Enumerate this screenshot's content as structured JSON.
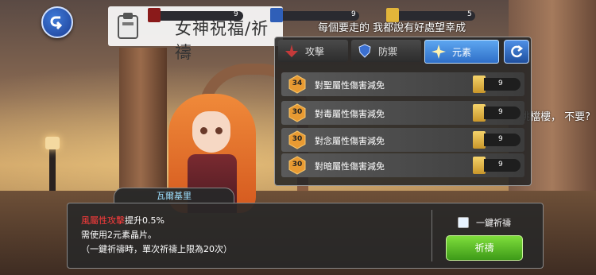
{
  "header": {
    "title": "女神祝福/祈禱",
    "stats": [
      {
        "icon": "red-shield-icon",
        "value": "9",
        "color": "#8a1a1a"
      },
      {
        "icon": "blue-shield-icon",
        "value": "9",
        "color": "#2f5fb8"
      },
      {
        "icon": "gold-star-icon",
        "value": "5",
        "color": "#e2b53a"
      }
    ]
  },
  "overlay_text": {
    "top": "每個要走的  我都說有好處望幸成",
    "skip": "跳檔樓，   不要?"
  },
  "tabs": [
    {
      "label": "攻擊",
      "icon": "attack-icon",
      "active": false
    },
    {
      "label": "防禦",
      "icon": "defense-icon",
      "active": false
    },
    {
      "label": "元素",
      "icon": "element-icon",
      "active": true
    }
  ],
  "resist_rows": [
    {
      "level": "34",
      "label": "對聖屬性傷害減免",
      "cost": "9"
    },
    {
      "level": "30",
      "label": "對毒屬性傷害減免",
      "cost": "9"
    },
    {
      "level": "30",
      "label": "對念屬性傷害減免",
      "cost": "9"
    },
    {
      "level": "30",
      "label": "對暗屬性傷害減免",
      "cost": "9"
    }
  ],
  "npc_name": "瓦爾基里",
  "info": {
    "attr_red": "風屬性攻擊",
    "attr_white": "提升0.5%",
    "cost_line": "需使用2元素晶片。",
    "note_line": "（一鍵祈禱時，單次祈禱上限為20次）"
  },
  "one_click": "一鍵祈禱",
  "pray_button": "祈禱",
  "colors": {
    "accent_blue": "#3f7ad8",
    "pray_green": "#5bbd2a",
    "highlight_red": "#ff3c3c",
    "gem_gold": "#e2b53a"
  }
}
